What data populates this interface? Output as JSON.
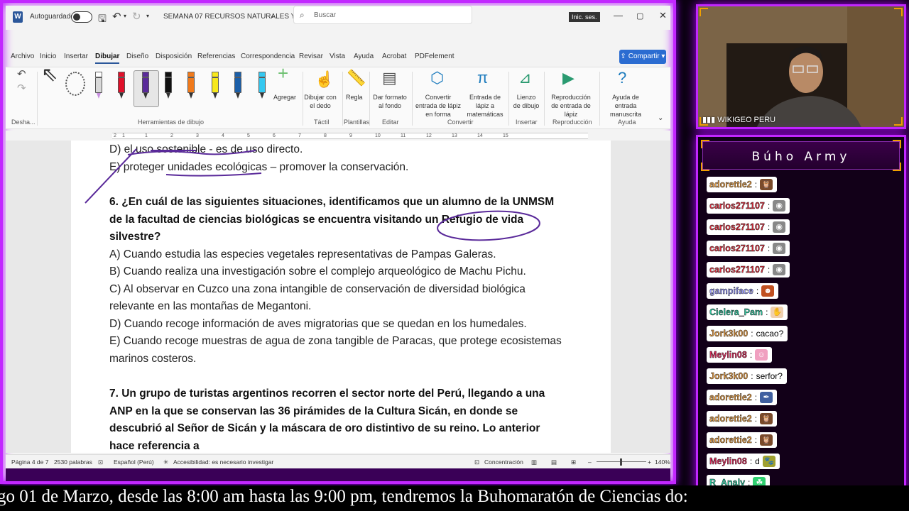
{
  "titlebar": {
    "autosave_label": "Autoguardado",
    "doc_title": "SEMANA 07 RECURSOS NATURALES Y...",
    "search_placeholder": "Buscar",
    "signin_label": "Inic. ses."
  },
  "menu": {
    "items": [
      "Archivo",
      "Inicio",
      "Insertar",
      "Dibujar",
      "Diseño",
      "Disposición",
      "Referencias",
      "Correspondencia",
      "Revisar",
      "Vista",
      "Ayuda",
      "Acrobat",
      "PDFelement"
    ],
    "active": "Dibujar",
    "share_label": "Compartir"
  },
  "ribbon": {
    "undo_group_label": "Desha...",
    "drawing_tools_label": "Herramientas de dibujo",
    "add_label": "Agregar",
    "draw_with_finger_label": "Dibujar con el dedo",
    "tactil_label": "Táctil",
    "ruler_label": "Regla",
    "plantillas_label": "Plantillas",
    "format_bg_label": "Dar formato al fondo",
    "editar_label": "Editar",
    "ink_to_shape_label": "Convertir entrada de lápiz en forma",
    "ink_to_math_label": "Entrada de lápiz a matemáticas",
    "convertir_label": "Convertir",
    "drawing_canvas_label": "Lienzo de dibujo",
    "insertar_label": "Insertar",
    "ink_replay_label": "Reproducción de entrada de lápiz",
    "reproduccion_label": "Reproducción",
    "ink_help_label": "Ayuda de entrada manuscrita",
    "ayuda_label": "Ayuda",
    "pens": [
      {
        "color": "#ffffff",
        "kind": "eraser"
      },
      {
        "color": "#e0102a",
        "kind": "pen"
      },
      {
        "color": "#5a2a9a",
        "kind": "pen"
      },
      {
        "color": "#111111",
        "kind": "pen"
      },
      {
        "color": "#f07a1c",
        "kind": "pen"
      },
      {
        "color": "#f7e81c",
        "kind": "highlighter"
      },
      {
        "color": "#1b5fa8",
        "kind": "pen"
      },
      {
        "color": "#35c8f0",
        "kind": "highlighter"
      }
    ]
  },
  "ruler_numbers": [
    "1",
    "2",
    "1",
    "2",
    "3",
    "4",
    "5",
    "6",
    "7",
    "8",
    "9",
    "10",
    "11",
    "12",
    "13",
    "14",
    "15"
  ],
  "document": {
    "lines": [
      {
        "text": "D) el uso sostenible - es de uso directo.",
        "bold": false
      },
      {
        "text": "E) proteger unidades ecológicas – promover la conservación.",
        "bold": false
      },
      {
        "text": "6. ¿En cuál de las siguientes situaciones, identificamos que un alumno de la UNMSM",
        "bold": true
      },
      {
        "text": "de la facultad de ciencias biológicas se encuentra visitando un Refugio de vida",
        "bold": true
      },
      {
        "text": "silvestre?",
        "bold": true
      },
      {
        "text": "A) Cuando estudia las especies vegetales representativas de Pampas Galeras.",
        "bold": false
      },
      {
        "text": "B) Cuando realiza una investigación sobre el complejo arqueológico de Machu Pichu.",
        "bold": false
      },
      {
        "text": "C) Al observar en Cuzco una zona intangible de conservación de diversidad biológica",
        "bold": false
      },
      {
        "text": "relevante en las montañas de Megantoni.",
        "bold": false
      },
      {
        "text": "D) Cuando recoge información de aves migratorias que se quedan en los humedales.",
        "bold": false
      },
      {
        "text": "E) Cuando recoge muestras de agua de zona tangible de Paracas, que protege ecosistemas",
        "bold": false
      },
      {
        "text": "marinos costeros.",
        "bold": false
      },
      {
        "text": "7. Un grupo de turistas argentinos recorren el sector norte del Perú, llegando a una",
        "bold": true
      },
      {
        "text": "ANP en la que se conservan las 36 pirámides de la Cultura Sicán, en donde se",
        "bold": true
      },
      {
        "text": "descubrió al Señor de Sicán y la máscara de oro distintivo de su reino. Lo anterior",
        "bold": true
      },
      {
        "text": "hace referencia a",
        "bold": true
      }
    ]
  },
  "status": {
    "page": "Página 4 de 7",
    "words": "2530 palabras",
    "language": "Español (Perú)",
    "accessibility": "Accesibilidad: es necesario investigar",
    "focus": "Concentración",
    "zoom": "140%"
  },
  "webcam": {
    "label": "WIKIGEO PERU"
  },
  "chat": {
    "title": "Búho Army",
    "messages": [
      {
        "user": "adorettie2",
        "color": "#e8a04a",
        "text": "",
        "emote": "owl",
        "emote_color": "#7a4a2a"
      },
      {
        "user": "carlos271107",
        "color": "#e03040",
        "text": "",
        "emote": "bot",
        "emote_color": "#888888"
      },
      {
        "user": "carlos271107",
        "color": "#e03040",
        "text": "",
        "emote": "bot",
        "emote_color": "#888888"
      },
      {
        "user": "carlos271107",
        "color": "#e03040",
        "text": "",
        "emote": "bot",
        "emote_color": "#888888"
      },
      {
        "user": "carlos271107",
        "color": "#e03040",
        "text": "",
        "emote": "bot",
        "emote_color": "#888888"
      },
      {
        "user": "gampiface",
        "color": "#9fa0ff",
        "text": "",
        "emote": "face",
        "emote_color": "#c05020"
      },
      {
        "user": "Cielera_Pam",
        "color": "#30c8a0",
        "text": "",
        "emote": "hand",
        "emote_color": "#f0d0b0"
      },
      {
        "user": "Jork3k00",
        "color": "#e8a04a",
        "text": "cacao?",
        "emote": "",
        "emote_color": ""
      },
      {
        "user": "Meylin08",
        "color": "#e03060",
        "text": "",
        "emote": "anime",
        "emote_color": "#f0a0c0"
      },
      {
        "user": "Jork3k00",
        "color": "#e8a04a",
        "text": "serfor?",
        "emote": "",
        "emote_color": ""
      },
      {
        "user": "adorettie2",
        "color": "#e8a04a",
        "text": "",
        "emote": "feather",
        "emote_color": "#4060a0"
      },
      {
        "user": "adorettie2",
        "color": "#e8a04a",
        "text": "",
        "emote": "owl",
        "emote_color": "#7a4a2a"
      },
      {
        "user": "adorettie2",
        "color": "#e8a04a",
        "text": "",
        "emote": "owl",
        "emote_color": "#7a4a2a"
      },
      {
        "user": "Meylin08",
        "color": "#e03060",
        "text": "d",
        "emote": "cat",
        "emote_color": "#a0a030"
      },
      {
        "user": "R_Analy",
        "color": "#30c8a0",
        "text": "",
        "emote": "frog",
        "emote_color": "#30d070"
      }
    ]
  },
  "ticker": {
    "text": "go 01 de Marzo, desde las 8:00 am hasta las 9:00 pm, tendremos la Buhomaratón de Ciencias do:"
  },
  "colors": {
    "frame_neon": "#c227ff",
    "word_accent": "#2b579a",
    "ink_purple": "#5a2a9a"
  }
}
